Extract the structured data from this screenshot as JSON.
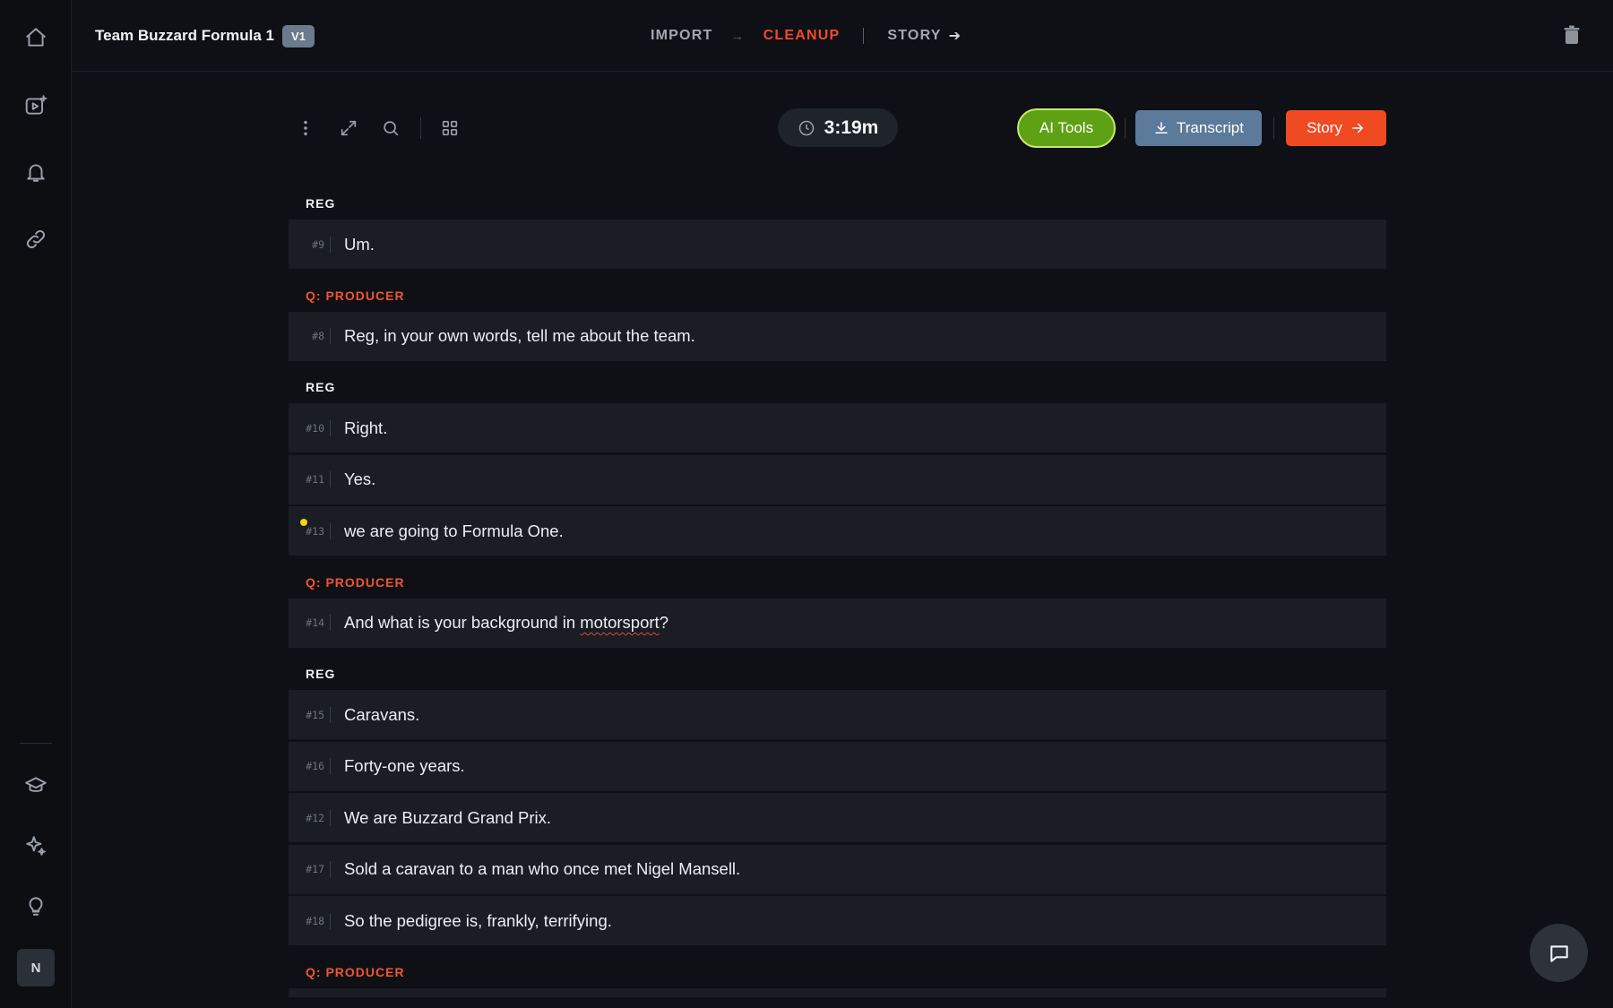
{
  "header": {
    "project_title": "Team Buzzard Formula 1",
    "version": "V1",
    "steps": [
      {
        "label": "IMPORT",
        "active": false
      },
      {
        "label": "CLEANUP",
        "active": true
      },
      {
        "label": "STORY",
        "active": false
      }
    ]
  },
  "toolbar": {
    "duration": "3:19m",
    "ai_tools_label": "AI Tools",
    "transcript_label": "Transcript",
    "story_label": "Story"
  },
  "sidebar": {
    "avatar_initial": "N",
    "icons": [
      "home-icon",
      "video-add-icon",
      "bell-icon",
      "link-icon",
      "graduation-cap-icon",
      "sparkle-icon",
      "lightbulb-icon"
    ]
  },
  "transcript": {
    "blocks": [
      {
        "speaker": "REG",
        "type": "answer",
        "lines": [
          {
            "num": "#9",
            "text": "Um."
          }
        ]
      },
      {
        "speaker": "Q: PRODUCER",
        "type": "question",
        "lines": [
          {
            "num": "#8",
            "text": "Reg, in your own words, tell me about the team."
          }
        ]
      },
      {
        "speaker": "REG",
        "type": "answer",
        "lines": [
          {
            "num": "#10",
            "text": "Right."
          },
          {
            "num": "#11",
            "text": "Yes."
          },
          {
            "num": "#13",
            "text": "we are going to Formula One."
          }
        ]
      },
      {
        "speaker": "Q: PRODUCER",
        "type": "question",
        "lines": [
          {
            "num": "#14",
            "text_before": "And what is your background in ",
            "text_flagged": "motorsport",
            "text_after": "?"
          }
        ]
      },
      {
        "speaker": "REG",
        "type": "answer",
        "lines": [
          {
            "num": "#15",
            "text": "Caravans."
          },
          {
            "num": "#16",
            "text": "Forty-one years."
          },
          {
            "num": "#12",
            "text": "We are Buzzard Grand Prix."
          },
          {
            "num": "#17",
            "text": "Sold a caravan to a man who once met Nigel Mansell."
          },
          {
            "num": "#18",
            "text": "So the pedigree is, frankly, terrifying."
          }
        ]
      },
      {
        "speaker": "Q: PRODUCER",
        "type": "question",
        "lines": []
      }
    ]
  },
  "colors": {
    "accent": "#f04a2a",
    "ai_green": "#5ea114",
    "transcript_blue": "#5c7a99",
    "marker_yellow": "#f6d313"
  }
}
